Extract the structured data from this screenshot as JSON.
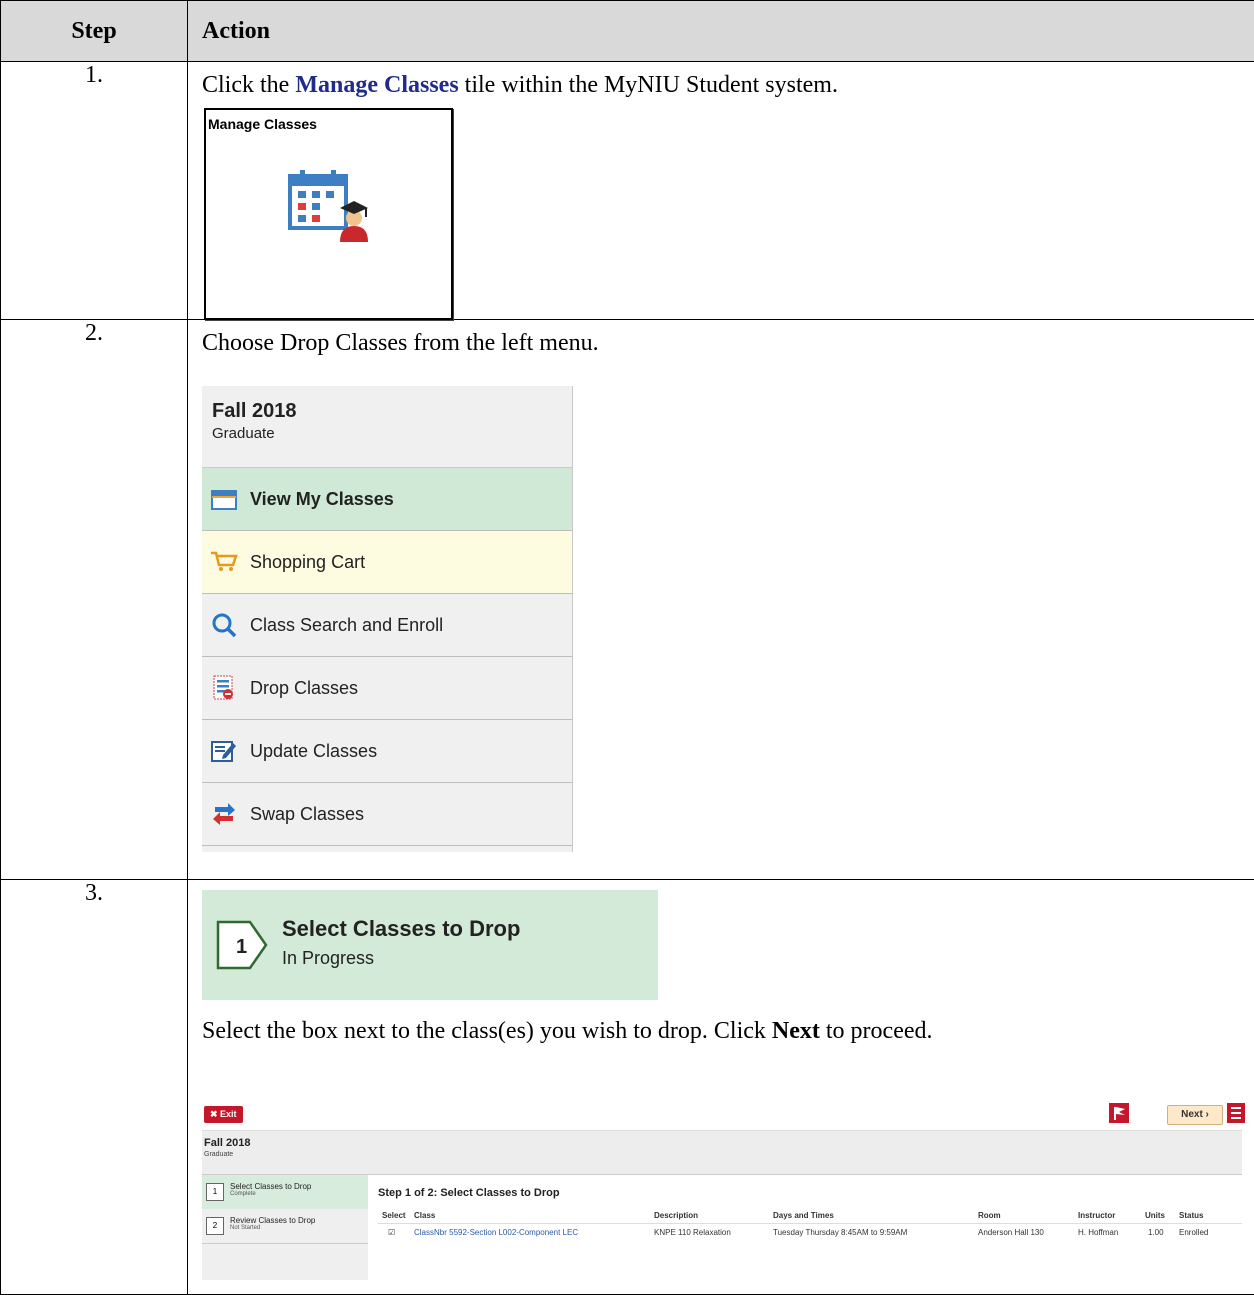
{
  "table": {
    "header_step": "Step",
    "header_action": "Action"
  },
  "row1": {
    "number": "1.",
    "text_before": "Click the ",
    "text_bold": "Manage Classes",
    "text_after": " tile within the MyNIU Student system.",
    "tile_title": "Manage Classes",
    "tile_icon": "calendar-graduate-icon"
  },
  "row2": {
    "number": "2.",
    "text": "Choose Drop Classes from the left menu.",
    "menu": {
      "term": "Fall 2018",
      "career": "Graduate",
      "items": [
        {
          "label": "View My Classes",
          "icon": "calendar-icon"
        },
        {
          "label": "Shopping Cart",
          "icon": "shopping-cart-icon"
        },
        {
          "label": "Class Search and Enroll",
          "icon": "search-icon"
        },
        {
          "label": "Drop Classes",
          "icon": "drop-list-icon"
        },
        {
          "label": "Update Classes",
          "icon": "edit-icon"
        },
        {
          "label": "Swap Classes",
          "icon": "swap-arrows-icon"
        }
      ]
    }
  },
  "row3": {
    "number": "3.",
    "banner_step": "1",
    "banner_title": "Select Classes to Drop",
    "banner_status": "In Progress",
    "text_before": "Select the box next to the class(es) you wish to drop. Click ",
    "text_bold": "Next",
    "text_after": " to proceed.",
    "screenshot": {
      "exit_label": "✖ Exit",
      "next_label": "Next  ›",
      "term": "Fall 2018",
      "career": "Graduate",
      "steps": [
        {
          "num": "1",
          "title": "Select Classes to Drop",
          "status": "Complete"
        },
        {
          "num": "2",
          "title": "Review Classes to Drop",
          "status": "Not Started"
        }
      ],
      "step_heading": "Step 1 of 2: Select Classes to Drop",
      "columns": [
        "Select",
        "Class",
        "Description",
        "Days and Times",
        "Room",
        "Instructor",
        "Units",
        "Status"
      ],
      "row": {
        "select": "☑",
        "class": "ClassNbr 5592-Section L002-Component LEC",
        "description": "KNPE 110  Relaxation",
        "days_times": "Tuesday Thursday  8:45AM to 9:59AM",
        "room": "Anderson Hall 130",
        "instructor": "H. Hoffman",
        "units": "1.00",
        "status": "Enrolled"
      }
    }
  },
  "colors": {
    "header_bg": "#d9d9d9",
    "link_bold": "#1f2c8a",
    "active_green": "#d0e9d6",
    "cart_yellow": "#fdfbe0",
    "niu_red": "#c4172c"
  }
}
